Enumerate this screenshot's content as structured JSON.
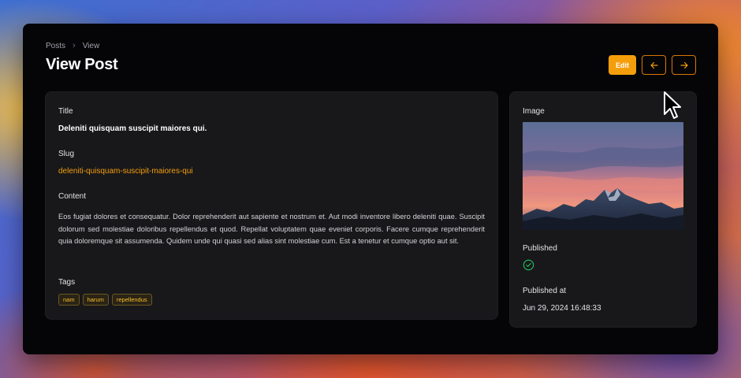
{
  "breadcrumb": {
    "items": [
      "Posts",
      "View"
    ],
    "separator": "›"
  },
  "page": {
    "title": "View Post"
  },
  "actions": {
    "edit_label": "Edit",
    "prev_icon": "arrow-left-icon",
    "next_icon": "arrow-right-icon"
  },
  "post": {
    "title_label": "Title",
    "title_value": "Deleniti quisquam suscipit maiores qui.",
    "slug_label": "Slug",
    "slug_value": "deleniti-quisquam-suscipit-maiores-qui",
    "content_label": "Content",
    "content_value": "Eos fugiat dolores et consequatur. Dolor reprehenderit aut sapiente et nostrum et. Aut modi inventore libero deleniti quae. Suscipit dolorum sed molestiae doloribus repellendus et quod. Repellat voluptatem quae eveniet corporis. Facere cumque reprehenderit quia doloremque sit assumenda. Quidem unde qui quasi sed alias sint molestiae cum. Est a tenetur et cumque optio aut sit.",
    "tags_label": "Tags",
    "tags": [
      "nam",
      "harum",
      "repellendus"
    ]
  },
  "side": {
    "image_label": "Image",
    "published_label": "Published",
    "published_icon": "check-circle-icon",
    "published_at_label": "Published at",
    "published_at_value": "Jun 29, 2024 16:48:33"
  },
  "colors": {
    "accent": "#f59e0b",
    "card_bg": "#18181b",
    "window_bg": "#050507",
    "success": "#22c55e"
  }
}
